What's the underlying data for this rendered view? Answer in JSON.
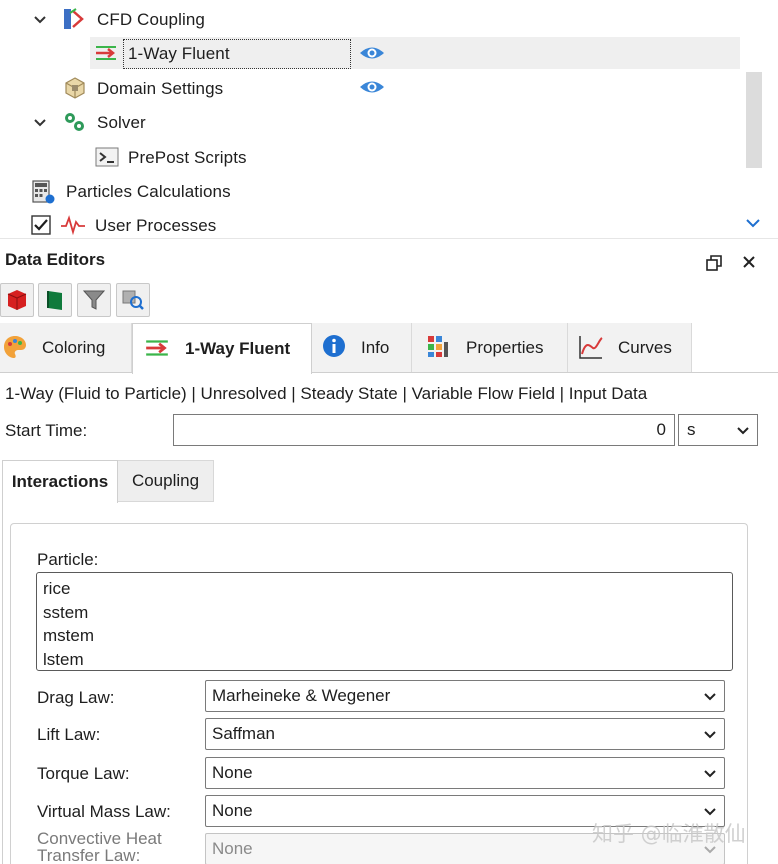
{
  "tree": {
    "items": [
      {
        "label": "CFD Coupling",
        "expanded": true,
        "icon": "cfd-coupling-icon"
      },
      {
        "label": "1-Way Fluent",
        "selected": true,
        "icon": "one-way-fluent-icon",
        "visible_eye": true
      },
      {
        "label": "Domain Settings",
        "icon": "domain-settings-icon",
        "visible_eye": true
      },
      {
        "label": "Solver",
        "expanded": true,
        "icon": "solver-gears-icon"
      },
      {
        "label": "PrePost Scripts",
        "icon": "terminal-icon"
      },
      {
        "label": "Particles Calculations",
        "icon": "calculator-icon"
      },
      {
        "label": "User Processes",
        "checked": true,
        "icon": "pulse-icon"
      }
    ]
  },
  "data_editors": {
    "title": "Data Editors"
  },
  "tabs": [
    {
      "label": "Coloring",
      "icon": "palette-icon"
    },
    {
      "label": "1-Way Fluent",
      "icon": "one-way-fluent-icon",
      "active": true
    },
    {
      "label": "Info",
      "icon": "info-icon"
    },
    {
      "label": "Properties",
      "icon": "properties-icon"
    },
    {
      "label": "Curves",
      "icon": "curves-icon"
    }
  ],
  "mode_line": "1-Way (Fluid to Particle) | Unresolved | Steady State | Variable Flow Field | Input Data",
  "start_time": {
    "label": "Start Time:",
    "value": "0",
    "unit": "s"
  },
  "subtabs": [
    {
      "label": "Interactions",
      "active": true
    },
    {
      "label": "Coupling"
    }
  ],
  "interactions": {
    "particle_label": "Particle:",
    "particles": [
      "rice",
      "sstem",
      "mstem",
      "lstem"
    ],
    "drag_law": {
      "label": "Drag Law:",
      "value": "Marheineke & Wegener"
    },
    "lift_law": {
      "label": "Lift Law:",
      "value": "Saffman"
    },
    "torque_law": {
      "label": "Torque Law:",
      "value": "None"
    },
    "virtual_mass_law": {
      "label": "Virtual Mass Law:",
      "value": "None"
    },
    "convective_heat": {
      "label": "Convective Heat Transfer Law:",
      "value": "None"
    }
  },
  "watermark": "知乎 @临淮散仙",
  "colors": {
    "accent_blue": "#1e6fd0",
    "eye_blue": "#3a86d8",
    "selected_row": "#efefef"
  }
}
